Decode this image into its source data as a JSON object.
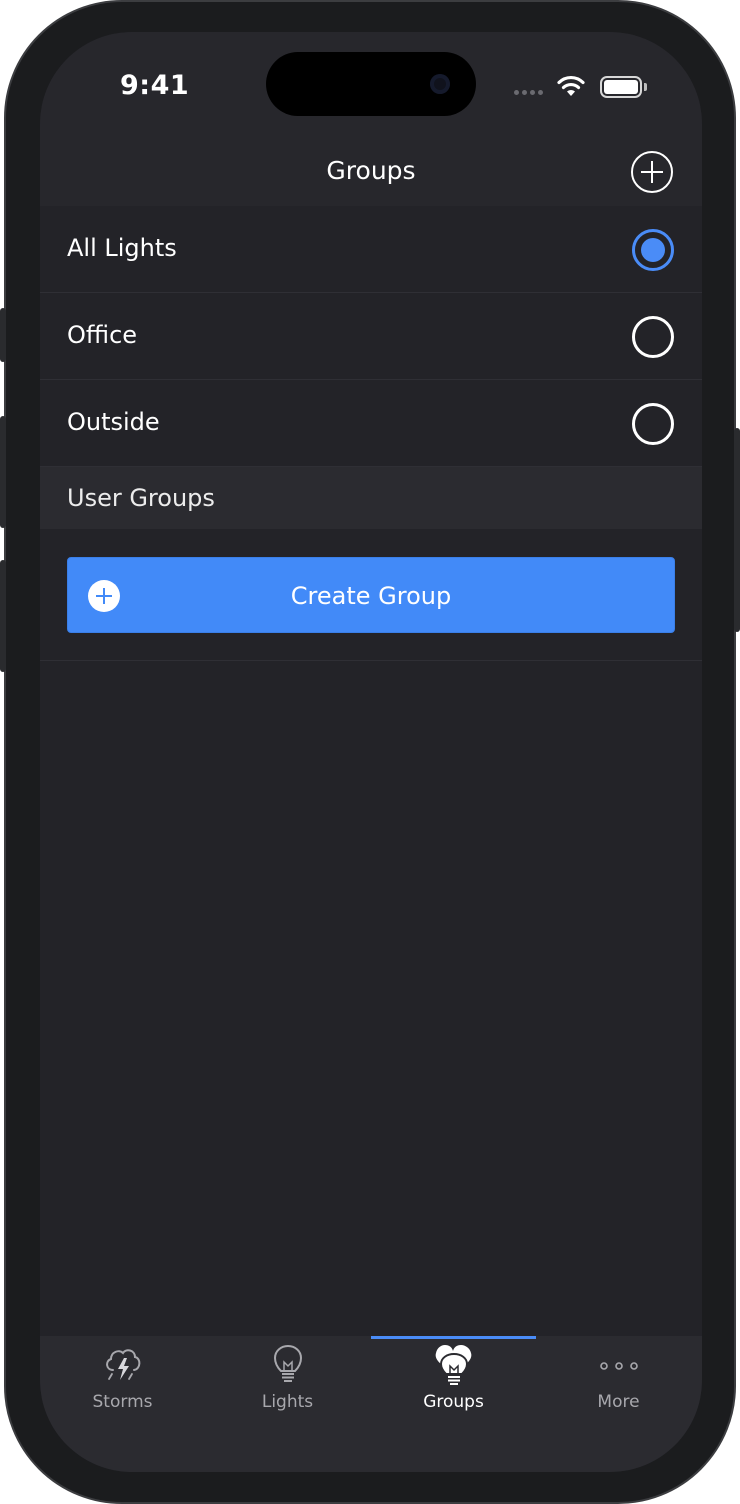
{
  "status_bar": {
    "time": "9:41"
  },
  "nav": {
    "title": "Groups"
  },
  "groups": [
    {
      "label": "All Lights",
      "selected": true
    },
    {
      "label": "Office",
      "selected": false
    },
    {
      "label": "Outside",
      "selected": false
    }
  ],
  "section": {
    "user_groups_label": "User Groups"
  },
  "create_group": {
    "label": "Create Group"
  },
  "tabs": [
    {
      "label": "Storms",
      "icon": "storm-cloud-icon",
      "active": false
    },
    {
      "label": "Lights",
      "icon": "light-bulb-icon",
      "active": false
    },
    {
      "label": "Groups",
      "icon": "light-bulbs-group-icon",
      "active": true
    },
    {
      "label": "More",
      "icon": "more-dots-icon",
      "active": false
    }
  ],
  "colors": {
    "accent": "#4a8cf7",
    "button": "#428af8",
    "background": "#232328",
    "bar": "#27272c",
    "tab_bar": "#2b2b30"
  }
}
